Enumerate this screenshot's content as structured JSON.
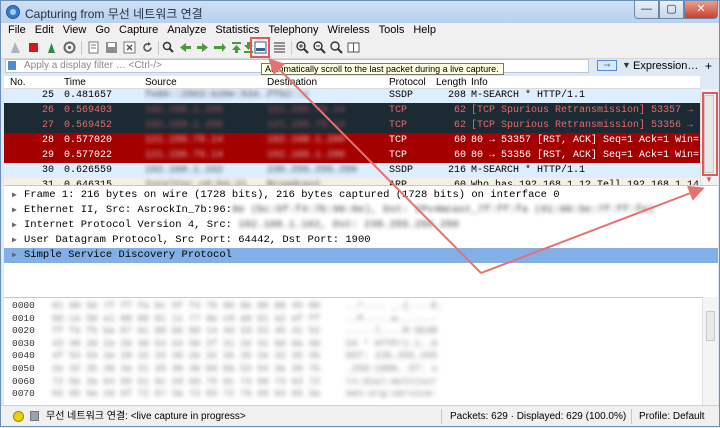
{
  "window": {
    "title": "Capturing from 무선 네트워크 연결",
    "min_label": "—",
    "max_label": "▢",
    "close_label": "✕"
  },
  "menu": [
    "File",
    "Edit",
    "View",
    "Go",
    "Capture",
    "Analyze",
    "Statistics",
    "Telephony",
    "Wireless",
    "Tools",
    "Help"
  ],
  "filter": {
    "placeholder": "Apply a display filter … <Ctrl-/>",
    "expression_label": "Expression…",
    "plus_label": "+"
  },
  "tooltip": "Automatically scroll to the last packet during a live capture.",
  "packet_list": {
    "columns": [
      "No.",
      "Time",
      "Source",
      "Destination",
      "Protocol",
      "Length",
      "Info"
    ],
    "rows": [
      {
        "no": "25",
        "time": "0.481657",
        "source": "fe80::2503:620e:534..",
        "destination": "ff02::c",
        "protocol": "SSDP",
        "length": "208",
        "info": "M-SEARCH * HTTP/1.1",
        "style": "ssdp"
      },
      {
        "no": "26",
        "time": "0.569403",
        "source": "192.168.1.200",
        "destination": "121.156.79.14",
        "protocol": "TCP",
        "length": "62",
        "info": "[TCP Spurious Retransmission] 53357 →",
        "style": "dark"
      },
      {
        "no": "27",
        "time": "0.569452",
        "source": "192.168.1.200",
        "destination": "121.156.79.14",
        "protocol": "TCP",
        "length": "62",
        "info": "[TCP Spurious Retransmission] 53356 →",
        "style": "dark"
      },
      {
        "no": "28",
        "time": "0.577020",
        "source": "121.156.79.14",
        "destination": "192.168.1.200",
        "protocol": "TCP",
        "length": "60",
        "info": "80 → 53357 [RST, ACK] Seq=1 Ack=1 Win=",
        "style": "red"
      },
      {
        "no": "29",
        "time": "0.577022",
        "source": "121.156.79.14",
        "destination": "192.168.1.200",
        "protocol": "TCP",
        "length": "60",
        "info": "80 → 53356 [RST, ACK] Seq=1 Ack=1 Win=",
        "style": "red"
      },
      {
        "no": "30",
        "time": "0.626559",
        "source": "192.168.1.162",
        "destination": "239.255.255.250",
        "protocol": "SSDP",
        "length": "216",
        "info": "M-SEARCH * HTTP/1.1",
        "style": "ssdp"
      },
      {
        "no": "31",
        "time": "0.646315",
        "source": "IntelCor_c0:b4:21",
        "destination": "Broadcast",
        "protocol": "ARP",
        "length": "60",
        "info": "Who has 192.168.1.1? Tell 192.168.1.142",
        "style": "arp"
      }
    ]
  },
  "details": [
    {
      "text": "Frame 1: 216 bytes on wire (1728 bits), 216 bytes captured (1728 bits) on interface 0",
      "blur": ""
    },
    {
      "text": "Ethernet II, Src: AsrockIn_7b:96:",
      "blur": "8e (bc:5f:f4:7b:96:8e), Dst: IPv4mcast_7f:ff:fa (01:00:5e:7f:ff:fa)"
    },
    {
      "text": "Internet Protocol Version 4, Src: ",
      "blur": "192.168.1.162, Dst: 239.255.255.250"
    },
    {
      "text": "User Datagram Protocol, Src Port: 64442, Dst Port: 1900",
      "blur": ""
    },
    {
      "text": "Simple Service Discovery Protocol",
      "blur": "",
      "selected": true
    }
  ],
  "bytes": [
    {
      "off": "0000",
      "hex": "01 00 5e 7f ff fa bc 5f  f4 7b 96 8e 08 00 45 00",
      "asc": "..^....  _.{....E."
    },
    {
      "off": "0010",
      "hex": "00 ca 50 a1 00 00 01 11  77 9e c0 a8 01 a2 ef ff",
      "asc": "..P.....w......."
    },
    {
      "off": "0020",
      "hex": "ff fa fb ba 07 6c 00 b6  8d 14 4d 2d 53 45 41 52",
      "asc": ".....l....M-SEAR"
    },
    {
      "off": "0030",
      "hex": "43 48 20 2a 20 48 54 54  50 2f 31 2e 31 0d 0a 48",
      "asc": "CH * HTTP/1.1..H"
    },
    {
      "off": "0040",
      "hex": "4f 53 54 3a 20 32 33 39  2e 32 35 35 2e 32 35 35",
      "asc": "OST: 239.255.255"
    },
    {
      "off": "0050",
      "hex": "2e 32 35 30 3a 31 39 30  30 0d 0a 53 54 3a 20 75",
      "asc": ".250:1900..ST: u"
    },
    {
      "off": "0060",
      "hex": "72 6e 3a 64 69 61 6c 2d  6d 75 6c 74 69 73 63 72",
      "asc": "rn:dial-multiscr"
    },
    {
      "off": "0070",
      "hex": "65 65 6e 2d 6f 72 67 3a  73 65 72 76 69 63 65 3a",
      "asc": "een-org:service:"
    }
  ],
  "status": {
    "capture": "무선 네트워크 연결: <live capture in progress>",
    "packets": "Packets: 629 · Displayed: 629 (100.0%)",
    "profile": "Profile: Default"
  },
  "colors": {
    "row_dark_bg": "#1c2a34",
    "row_dark_fg": "#e86a6a",
    "row_red_bg": "#a40000",
    "row_ssdp_bg": "#dceeff",
    "selection": "#82b0e6",
    "annotation": "#e05a5a"
  },
  "icons": [
    "shark-fin-start-icon",
    "stop-icon",
    "restart-icon",
    "options-gear-icon",
    "open-file-icon",
    "save-icon",
    "close-file-icon",
    "reload-icon",
    "find-icon",
    "go-back-icon",
    "go-forward-icon",
    "go-to-packet-icon",
    "go-first-icon",
    "go-last-icon",
    "autoscroll-icon",
    "colorize-icon",
    "zoom-in-icon",
    "zoom-out-icon",
    "zoom-normal-icon",
    "resize-columns-icon"
  ]
}
